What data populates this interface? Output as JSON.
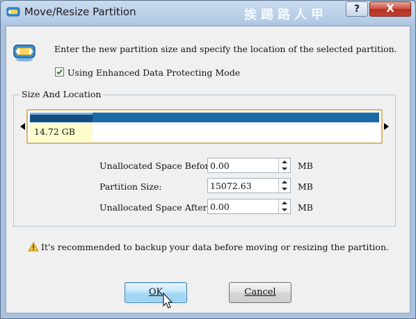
{
  "window": {
    "title": "Move/Resize Partition",
    "watermark": "挨踢路人甲",
    "help_label": "?",
    "close_label": "X"
  },
  "intro_text": "Enter the new partition size and specify the location of the selected partition.",
  "enhanced_mode": {
    "label": "Using Enhanced Data Protecting Mode",
    "checked": true
  },
  "size_location": {
    "group_label": "Size And Location",
    "partition_size_label": "14.72 GB",
    "used_fraction": 0.18
  },
  "fields": [
    {
      "label": "Unallocated Space Before:",
      "value": "0.00",
      "unit": "MB"
    },
    {
      "label": "Partition Size:",
      "value": "15072.63",
      "unit": "MB"
    },
    {
      "label": "Unallocated Space After:",
      "value": "0.00",
      "unit": "MB"
    }
  ],
  "warning_text": "It's recommended to backup your data before moving or resizing the partition.",
  "buttons": {
    "ok": "OK",
    "cancel": "Cancel"
  },
  "colors": {
    "bar": "#1a6aa8",
    "highlight": "#fffccd",
    "frame": "#d8b56b"
  }
}
